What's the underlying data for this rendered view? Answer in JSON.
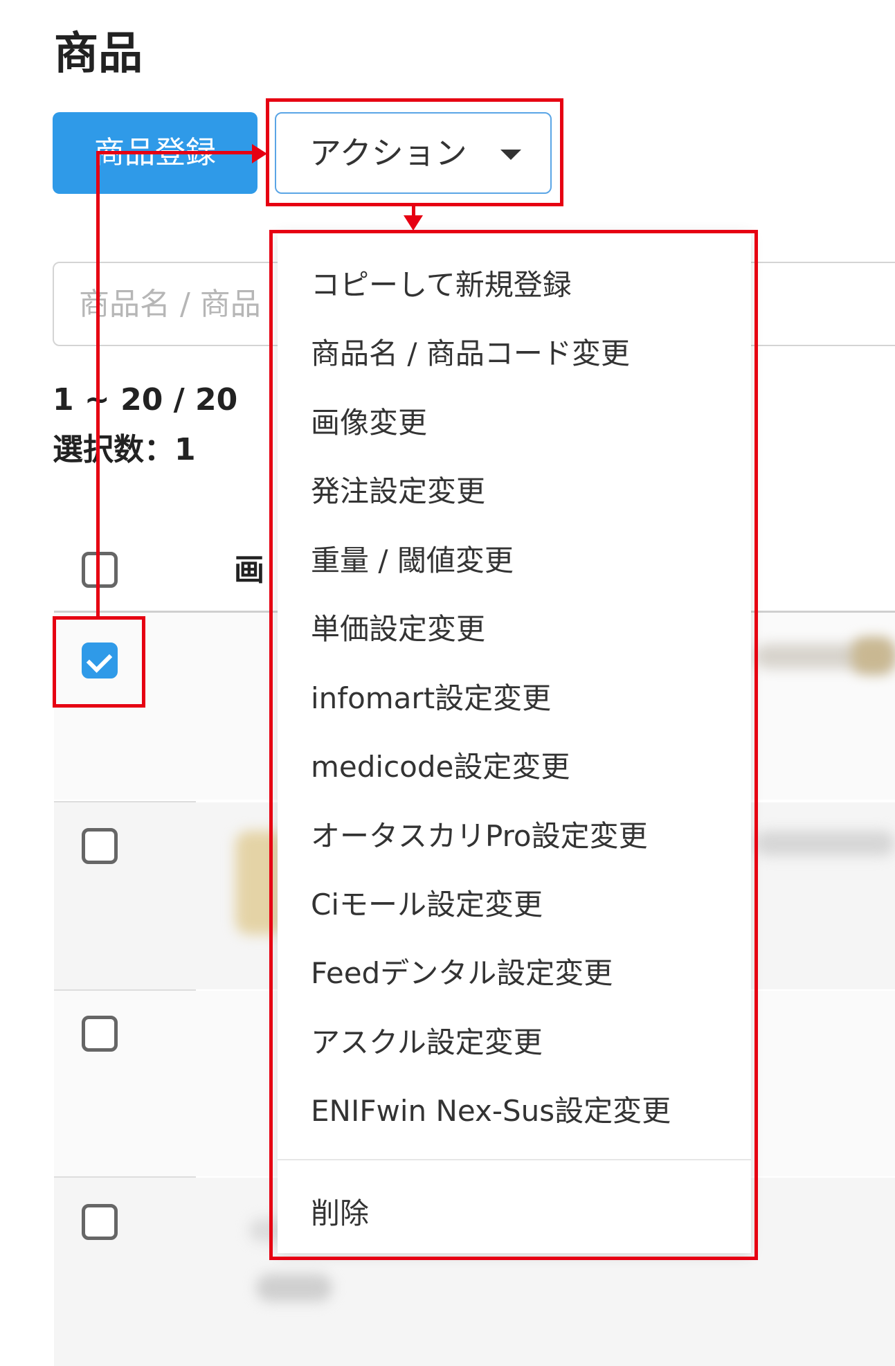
{
  "page": {
    "title": "商品"
  },
  "toolbar": {
    "register_label": "商品登録",
    "action_label": "アクション"
  },
  "search": {
    "placeholder": "商品名 / 商品"
  },
  "summary": {
    "count": "1 ~ 20 / 20",
    "selected": "選択数：1"
  },
  "table": {
    "header_image": "画"
  },
  "rows": [
    {
      "checked": true
    },
    {
      "checked": false
    },
    {
      "checked": false
    },
    {
      "checked": false
    }
  ],
  "action_menu": {
    "items": [
      "コピーして新規登録",
      "商品名 / 商品コード変更",
      "画像変更",
      "発注設定変更",
      "重量 / 閾値変更",
      "単価設定変更",
      "infomart設定変更",
      "medicode設定変更",
      "オータスカリPro設定変更",
      "Ciモール設定変更",
      "Feedデンタル設定変更",
      "アスクル設定変更",
      "ENIFwin Nex-Sus設定変更"
    ],
    "delete_label": "削除"
  },
  "colors": {
    "primary": "#2f9ae8",
    "annotation": "#e60012",
    "text": "#333333",
    "placeholder": "#b6b6b6"
  }
}
